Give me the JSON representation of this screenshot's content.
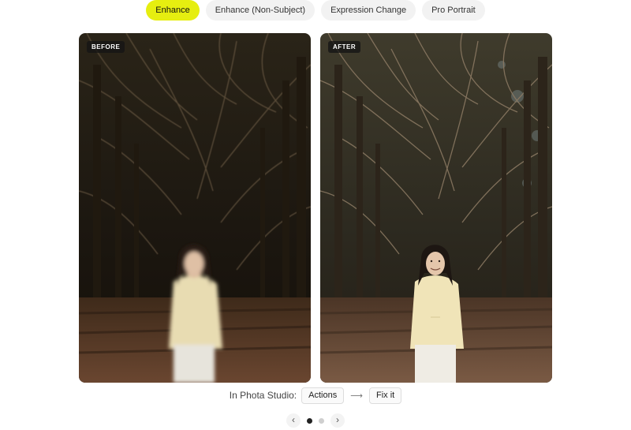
{
  "tabs": [
    {
      "label": "Enhance",
      "active": true
    },
    {
      "label": "Enhance (Non-Subject)",
      "active": false
    },
    {
      "label": "Expression Change",
      "active": false
    },
    {
      "label": "Pro Portrait",
      "active": false
    }
  ],
  "comparison": {
    "before_label": "BEFORE",
    "after_label": "AFTER"
  },
  "studio": {
    "prefix": "In Phota Studio:",
    "actions_label": "Actions",
    "arrow": "⟶",
    "fix_label": "Fix it"
  },
  "pager": {
    "prev_icon": "chevron-left-icon",
    "next_icon": "chevron-right-icon",
    "prev_glyph": "‹",
    "next_glyph": "›",
    "slide_count": 2,
    "current_slide": 1
  },
  "colors": {
    "active_tab": "#e6ee10",
    "tab_bg": "#f2f2f2",
    "dot_active": "#222222",
    "dot_inactive": "#cfcfcf"
  }
}
